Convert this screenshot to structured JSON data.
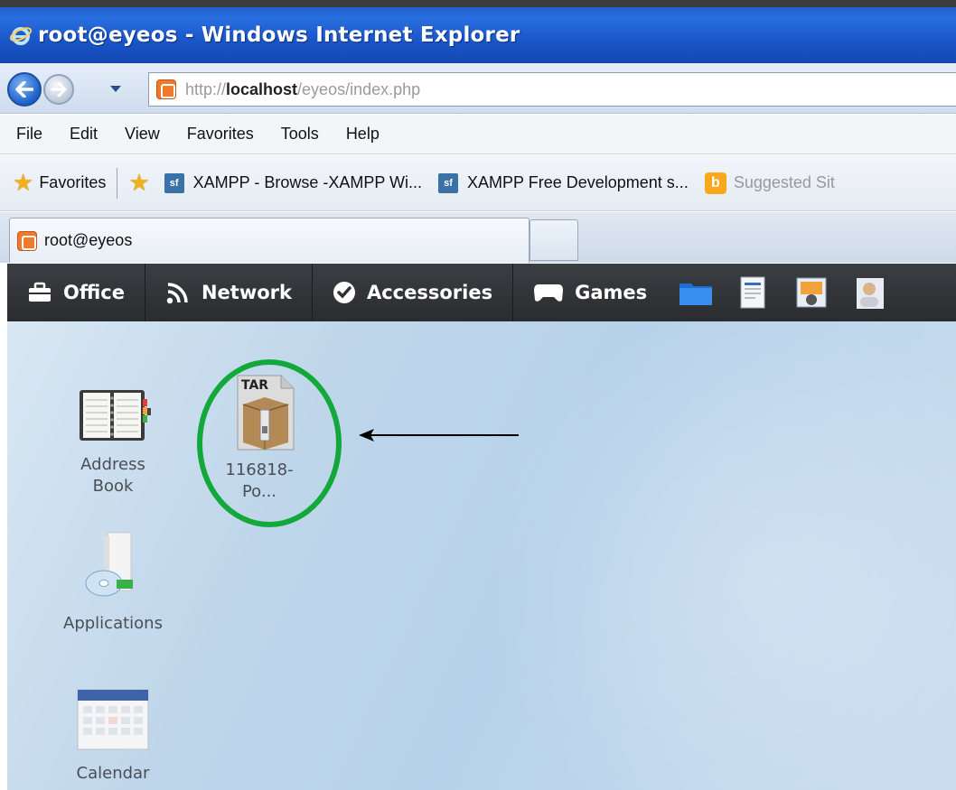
{
  "window": {
    "title": "root@eyeos - Windows Internet Explorer"
  },
  "address_bar": {
    "url_prefix": "http://",
    "url_host": "localhost",
    "url_path": "/eyeos/index.php"
  },
  "menu": {
    "items": [
      "File",
      "Edit",
      "View",
      "Favorites",
      "Tools",
      "Help"
    ]
  },
  "favorites_bar": {
    "favorites_label": "Favorites",
    "links": [
      {
        "icon": "sf",
        "label": "XAMPP - Browse -XAMPP Wi..."
      },
      {
        "icon": "sf",
        "label": "XAMPP  Free Development s..."
      }
    ],
    "suggested": "Suggested Sit"
  },
  "tabs": {
    "active_label": "root@eyeos"
  },
  "dock": {
    "items": [
      {
        "label": "Office",
        "icon": "briefcase-icon"
      },
      {
        "label": "Network",
        "icon": "rss-icon"
      },
      {
        "label": "Accessories",
        "icon": "check-circle-icon"
      },
      {
        "label": "Games",
        "icon": "gamepad-icon"
      }
    ],
    "quick_icons": [
      "folder-icon",
      "document-icon",
      "image-viewer-icon",
      "contacts-icon"
    ]
  },
  "desktop": {
    "icons": [
      {
        "label_line1": "Address",
        "label_line2": "Book",
        "icon": "address-book-icon"
      },
      {
        "label_line1": "116818-",
        "label_line2": "Po...",
        "icon": "tar-archive-icon",
        "badge": "TAR"
      },
      {
        "label_line1": "Applications",
        "label_line2": "",
        "icon": "applications-icon"
      },
      {
        "label_line1": "Calendar",
        "label_line2": "",
        "icon": "calendar-icon"
      }
    ]
  },
  "colors": {
    "titlebar": "#1a56c8",
    "dock": "#2f3134",
    "desktop": "#bcd5ea",
    "highlight": "#13a83a",
    "arrow": "#000000"
  }
}
